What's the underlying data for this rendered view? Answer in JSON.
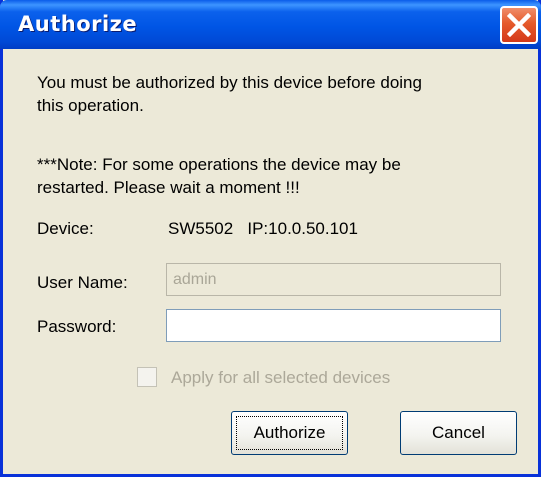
{
  "window": {
    "title": "Authorize"
  },
  "message": {
    "line1": "You must be authorized by this device before doing",
    "line2": "this operation."
  },
  "note": {
    "line1": "***Note: For some operations the device may be",
    "line2": "restarted. Please wait a moment !!!"
  },
  "device": {
    "label": "Device:",
    "value": "SW5502   IP:10.0.50.101"
  },
  "user_name": {
    "label": "User Name:",
    "value": "admin"
  },
  "password": {
    "label": "Password:",
    "value": ""
  },
  "apply_all": {
    "label": "Apply for all selected devices",
    "checked": false,
    "enabled": false
  },
  "buttons": {
    "authorize": "Authorize",
    "cancel": "Cancel"
  },
  "colors": {
    "titlebar": "#0055e5",
    "close": "#e55a2b",
    "dialog_bg": "#ece9d8"
  },
  "icons": {
    "close": "close-icon"
  }
}
